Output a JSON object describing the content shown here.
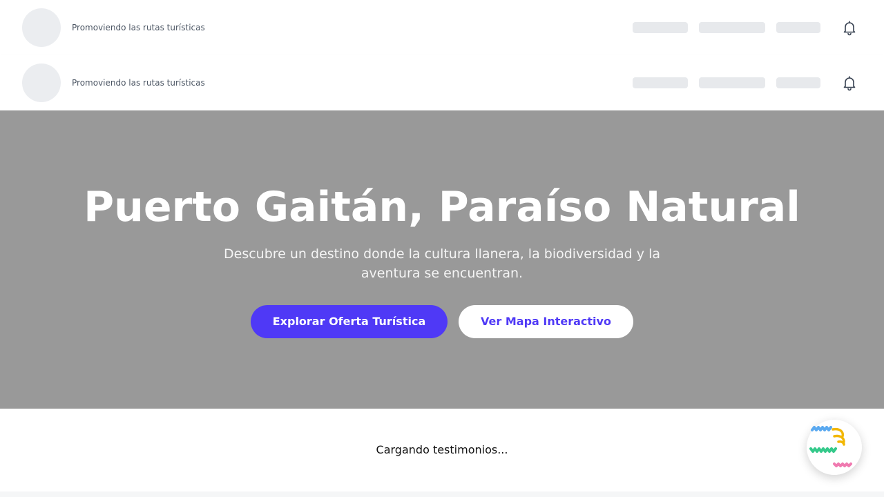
{
  "header": {
    "tagline": "Promoviendo las rutas turísticas"
  },
  "header_secondary": {
    "tagline": "Promoviendo las rutas turísticas"
  },
  "hero": {
    "title": "Puerto Gaitán, Paraíso Natural",
    "subtitle": "Descubre un destino donde la cultura llanera, la biodiversidad y la aventura se encuentran.",
    "primary_button": "Explorar Oferta Turística",
    "secondary_button": "Ver Mapa Interactivo"
  },
  "testimonials": {
    "loading_text": "Cargando testimonios..."
  },
  "colors": {
    "accent": "#4f39f6",
    "hero_background": "#999999",
    "skeleton": "#e7e9ec"
  },
  "icons": {
    "notification": "bell-icon",
    "widget": "chat-widget-icon"
  }
}
